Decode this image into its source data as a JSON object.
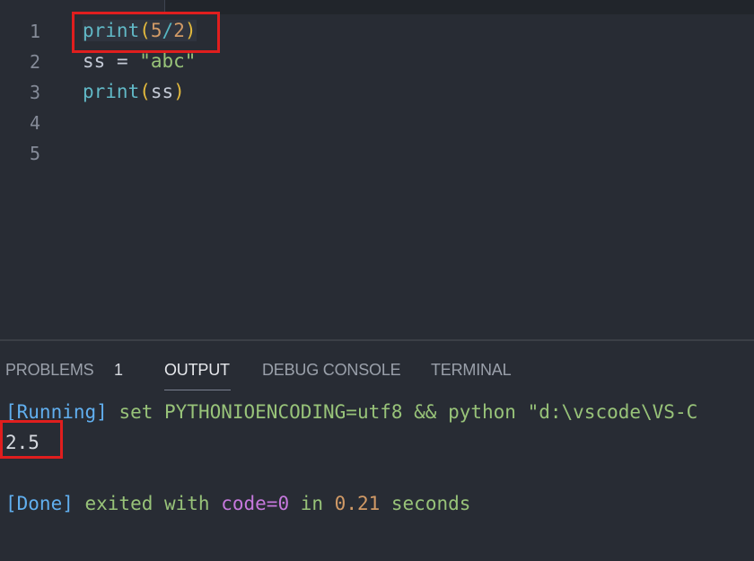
{
  "editor": {
    "line_numbers": [
      "1",
      "2",
      "3",
      "4",
      "5"
    ],
    "line1": {
      "fn": "print",
      "open": "(",
      "num1": "5",
      "op": "/",
      "num2": "2",
      "close": ")"
    },
    "line2": {
      "var": "ss",
      "eq": " = ",
      "str": "\"abc\""
    },
    "line3": {
      "fn": "print",
      "open": "(",
      "arg": "ss",
      "close": ")"
    }
  },
  "panel": {
    "tabs": [
      {
        "label": "PROBLEMS",
        "badge": "1"
      },
      {
        "label": "OUTPUT",
        "active": true
      },
      {
        "label": "DEBUG CONSOLE"
      },
      {
        "label": "TERMINAL"
      }
    ],
    "output": {
      "running_tag": "[Running]",
      "running_cmd": " set PYTHONIOENCODING=utf8 && python \"d:\\vscode\\VS-C",
      "result": "2.5",
      "done_tag": "[Done]",
      "done_text1": " exited with ",
      "done_code": "code=0",
      "done_text2": " in ",
      "done_time": "0.21",
      "done_text3": " seconds"
    }
  },
  "colors": {
    "background": "#282c34",
    "highlight_box": "#e01e1e",
    "accent_blue": "#61afef",
    "accent_green": "#98c379"
  }
}
